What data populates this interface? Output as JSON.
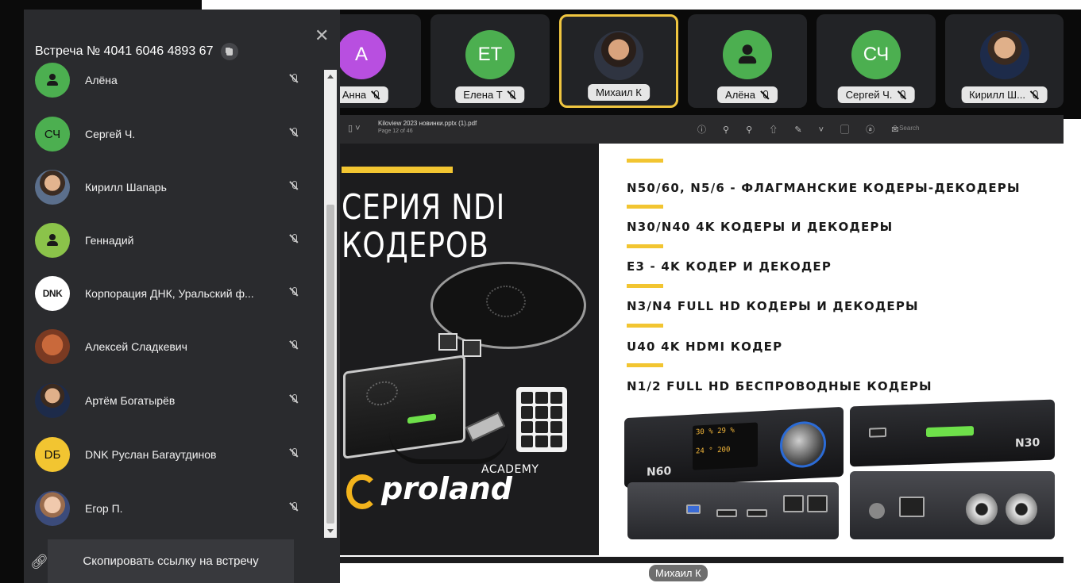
{
  "meeting": {
    "title": "Встреча № 4041 6046 4893 67",
    "copy_link_label": "Скопировать ссылку на встречу"
  },
  "colors": {
    "accent_yellow": "#f2c531",
    "active_speaker_border": "#f0c640",
    "panel_bg": "#2a2b2e"
  },
  "icons": {
    "close": "close-icon",
    "copy": "copy-icon",
    "mic_off": "mic-off-icon",
    "link": "link-icon",
    "person": "person-icon"
  },
  "tiles": [
    {
      "initials": "А",
      "name": "Анна",
      "color": "#b84fe0",
      "muted": true
    },
    {
      "initials": "ЕТ",
      "name": "Елена Т",
      "color": "#4caf50",
      "muted": true
    },
    {
      "initials": "",
      "name": "Михаил К",
      "color": "photo",
      "muted": false,
      "active": true
    },
    {
      "initials": "",
      "name": "Алёна",
      "color": "#4caf50",
      "muted": true
    },
    {
      "initials": "СЧ",
      "name": "Сергей Ч.",
      "color": "#4caf50",
      "muted": true
    },
    {
      "initials": "",
      "name": "Кирилл Ш...",
      "color": "photo",
      "muted": true
    }
  ],
  "participants": [
    {
      "name": "Алёна",
      "avatar": "person",
      "color": "#4caf50"
    },
    {
      "name": "Сергей Ч.",
      "avatar": "СЧ",
      "color": "#4caf50"
    },
    {
      "name": "Кирилл Шапарь",
      "avatar": "photo"
    },
    {
      "name": "Геннадий",
      "avatar": "person",
      "color": "#8bc34a"
    },
    {
      "name": "Корпорация ДНК, Уральский ф...",
      "avatar": "DNK"
    },
    {
      "name": "Алексей Сладкевич",
      "avatar": "photo"
    },
    {
      "name": "Артём Богатырёв",
      "avatar": "photo"
    },
    {
      "name": "DNK Руслан Багаутдинов",
      "avatar": "DБ",
      "color": "#f2c531"
    },
    {
      "name": "Егор П.",
      "avatar": "photo"
    }
  ],
  "pdf": {
    "filename": "Kiloview 2023 новинки.pptx (1).pdf",
    "page": "Page 12 of 46",
    "search_placeholder": "Search"
  },
  "slide": {
    "heading_line1": "СЕРИЯ NDI",
    "heading_line2": "КОДЕРОВ",
    "brand": "proland",
    "brand_sub": "ACADEMY",
    "features": [
      "N50/60, N5/6 - ФЛАГМАНСКИЕ КОДЕРЫ-ДЕКОДЕРЫ",
      "N30/N40 4K КОДЕРЫ И ДЕКОДЕРЫ",
      "E3 - 4K КОДЕР И ДЕКОДЕР",
      "N3/N4 FULL HD КОДЕРЫ И ДЕКОДЕРЫ",
      "U40 4K HDMI КОДЕР",
      "N1/2 FULL HD БЕСПРОВОДНЫЕ КОДЕРЫ"
    ],
    "device_labels": [
      "N60",
      "N30"
    ],
    "screen_values": [
      "30",
      "29",
      "24",
      "200"
    ]
  },
  "speaker_label": "Михаил К"
}
